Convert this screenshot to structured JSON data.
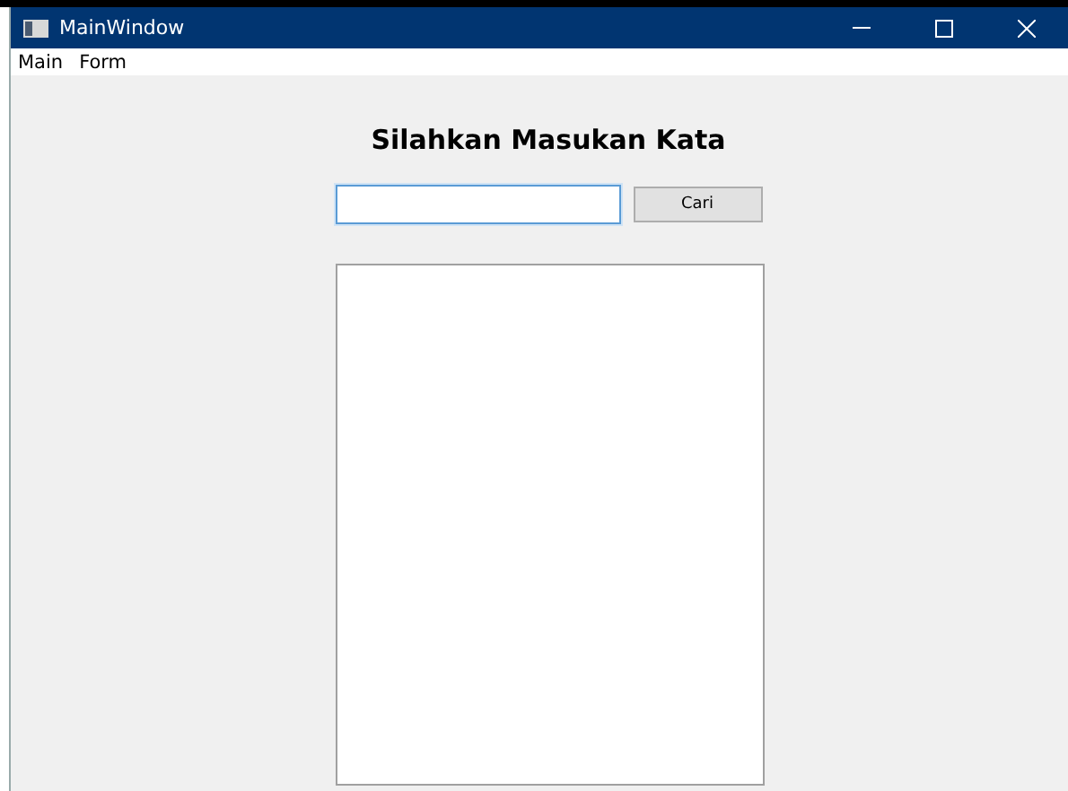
{
  "window": {
    "title": "MainWindow"
  },
  "menu": [
    "Main",
    "Form"
  ],
  "heading": "Silahkan Masukan Kata",
  "search": {
    "focused": true
  },
  "button": "Cari"
}
